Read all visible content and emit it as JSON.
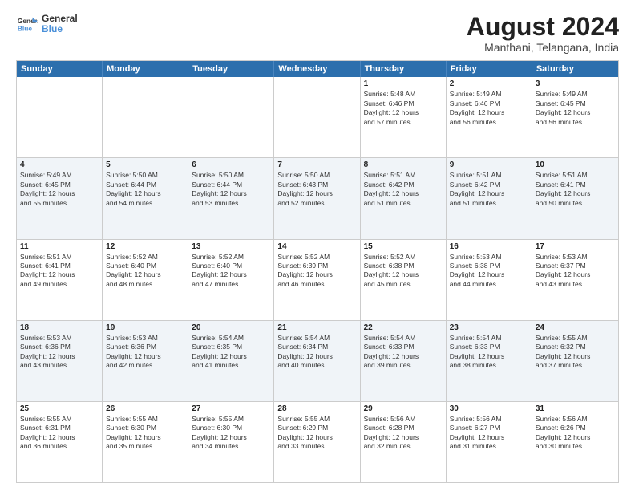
{
  "header": {
    "logo_line1": "General",
    "logo_line2": "Blue",
    "title": "August 2024",
    "subtitle": "Manthani, Telangana, India"
  },
  "weekdays": [
    "Sunday",
    "Monday",
    "Tuesday",
    "Wednesday",
    "Thursday",
    "Friday",
    "Saturday"
  ],
  "rows": [
    {
      "alt": false,
      "cells": [
        {
          "day": "",
          "text": ""
        },
        {
          "day": "",
          "text": ""
        },
        {
          "day": "",
          "text": ""
        },
        {
          "day": "",
          "text": ""
        },
        {
          "day": "1",
          "text": "Sunrise: 5:48 AM\nSunset: 6:46 PM\nDaylight: 12 hours\nand 57 minutes."
        },
        {
          "day": "2",
          "text": "Sunrise: 5:49 AM\nSunset: 6:46 PM\nDaylight: 12 hours\nand 56 minutes."
        },
        {
          "day": "3",
          "text": "Sunrise: 5:49 AM\nSunset: 6:45 PM\nDaylight: 12 hours\nand 56 minutes."
        }
      ]
    },
    {
      "alt": true,
      "cells": [
        {
          "day": "4",
          "text": "Sunrise: 5:49 AM\nSunset: 6:45 PM\nDaylight: 12 hours\nand 55 minutes."
        },
        {
          "day": "5",
          "text": "Sunrise: 5:50 AM\nSunset: 6:44 PM\nDaylight: 12 hours\nand 54 minutes."
        },
        {
          "day": "6",
          "text": "Sunrise: 5:50 AM\nSunset: 6:44 PM\nDaylight: 12 hours\nand 53 minutes."
        },
        {
          "day": "7",
          "text": "Sunrise: 5:50 AM\nSunset: 6:43 PM\nDaylight: 12 hours\nand 52 minutes."
        },
        {
          "day": "8",
          "text": "Sunrise: 5:51 AM\nSunset: 6:42 PM\nDaylight: 12 hours\nand 51 minutes."
        },
        {
          "day": "9",
          "text": "Sunrise: 5:51 AM\nSunset: 6:42 PM\nDaylight: 12 hours\nand 51 minutes."
        },
        {
          "day": "10",
          "text": "Sunrise: 5:51 AM\nSunset: 6:41 PM\nDaylight: 12 hours\nand 50 minutes."
        }
      ]
    },
    {
      "alt": false,
      "cells": [
        {
          "day": "11",
          "text": "Sunrise: 5:51 AM\nSunset: 6:41 PM\nDaylight: 12 hours\nand 49 minutes."
        },
        {
          "day": "12",
          "text": "Sunrise: 5:52 AM\nSunset: 6:40 PM\nDaylight: 12 hours\nand 48 minutes."
        },
        {
          "day": "13",
          "text": "Sunrise: 5:52 AM\nSunset: 6:40 PM\nDaylight: 12 hours\nand 47 minutes."
        },
        {
          "day": "14",
          "text": "Sunrise: 5:52 AM\nSunset: 6:39 PM\nDaylight: 12 hours\nand 46 minutes."
        },
        {
          "day": "15",
          "text": "Sunrise: 5:52 AM\nSunset: 6:38 PM\nDaylight: 12 hours\nand 45 minutes."
        },
        {
          "day": "16",
          "text": "Sunrise: 5:53 AM\nSunset: 6:38 PM\nDaylight: 12 hours\nand 44 minutes."
        },
        {
          "day": "17",
          "text": "Sunrise: 5:53 AM\nSunset: 6:37 PM\nDaylight: 12 hours\nand 43 minutes."
        }
      ]
    },
    {
      "alt": true,
      "cells": [
        {
          "day": "18",
          "text": "Sunrise: 5:53 AM\nSunset: 6:36 PM\nDaylight: 12 hours\nand 43 minutes."
        },
        {
          "day": "19",
          "text": "Sunrise: 5:53 AM\nSunset: 6:36 PM\nDaylight: 12 hours\nand 42 minutes."
        },
        {
          "day": "20",
          "text": "Sunrise: 5:54 AM\nSunset: 6:35 PM\nDaylight: 12 hours\nand 41 minutes."
        },
        {
          "day": "21",
          "text": "Sunrise: 5:54 AM\nSunset: 6:34 PM\nDaylight: 12 hours\nand 40 minutes."
        },
        {
          "day": "22",
          "text": "Sunrise: 5:54 AM\nSunset: 6:33 PM\nDaylight: 12 hours\nand 39 minutes."
        },
        {
          "day": "23",
          "text": "Sunrise: 5:54 AM\nSunset: 6:33 PM\nDaylight: 12 hours\nand 38 minutes."
        },
        {
          "day": "24",
          "text": "Sunrise: 5:55 AM\nSunset: 6:32 PM\nDaylight: 12 hours\nand 37 minutes."
        }
      ]
    },
    {
      "alt": false,
      "cells": [
        {
          "day": "25",
          "text": "Sunrise: 5:55 AM\nSunset: 6:31 PM\nDaylight: 12 hours\nand 36 minutes."
        },
        {
          "day": "26",
          "text": "Sunrise: 5:55 AM\nSunset: 6:30 PM\nDaylight: 12 hours\nand 35 minutes."
        },
        {
          "day": "27",
          "text": "Sunrise: 5:55 AM\nSunset: 6:30 PM\nDaylight: 12 hours\nand 34 minutes."
        },
        {
          "day": "28",
          "text": "Sunrise: 5:55 AM\nSunset: 6:29 PM\nDaylight: 12 hours\nand 33 minutes."
        },
        {
          "day": "29",
          "text": "Sunrise: 5:56 AM\nSunset: 6:28 PM\nDaylight: 12 hours\nand 32 minutes."
        },
        {
          "day": "30",
          "text": "Sunrise: 5:56 AM\nSunset: 6:27 PM\nDaylight: 12 hours\nand 31 minutes."
        },
        {
          "day": "31",
          "text": "Sunrise: 5:56 AM\nSunset: 6:26 PM\nDaylight: 12 hours\nand 30 minutes."
        }
      ]
    }
  ]
}
